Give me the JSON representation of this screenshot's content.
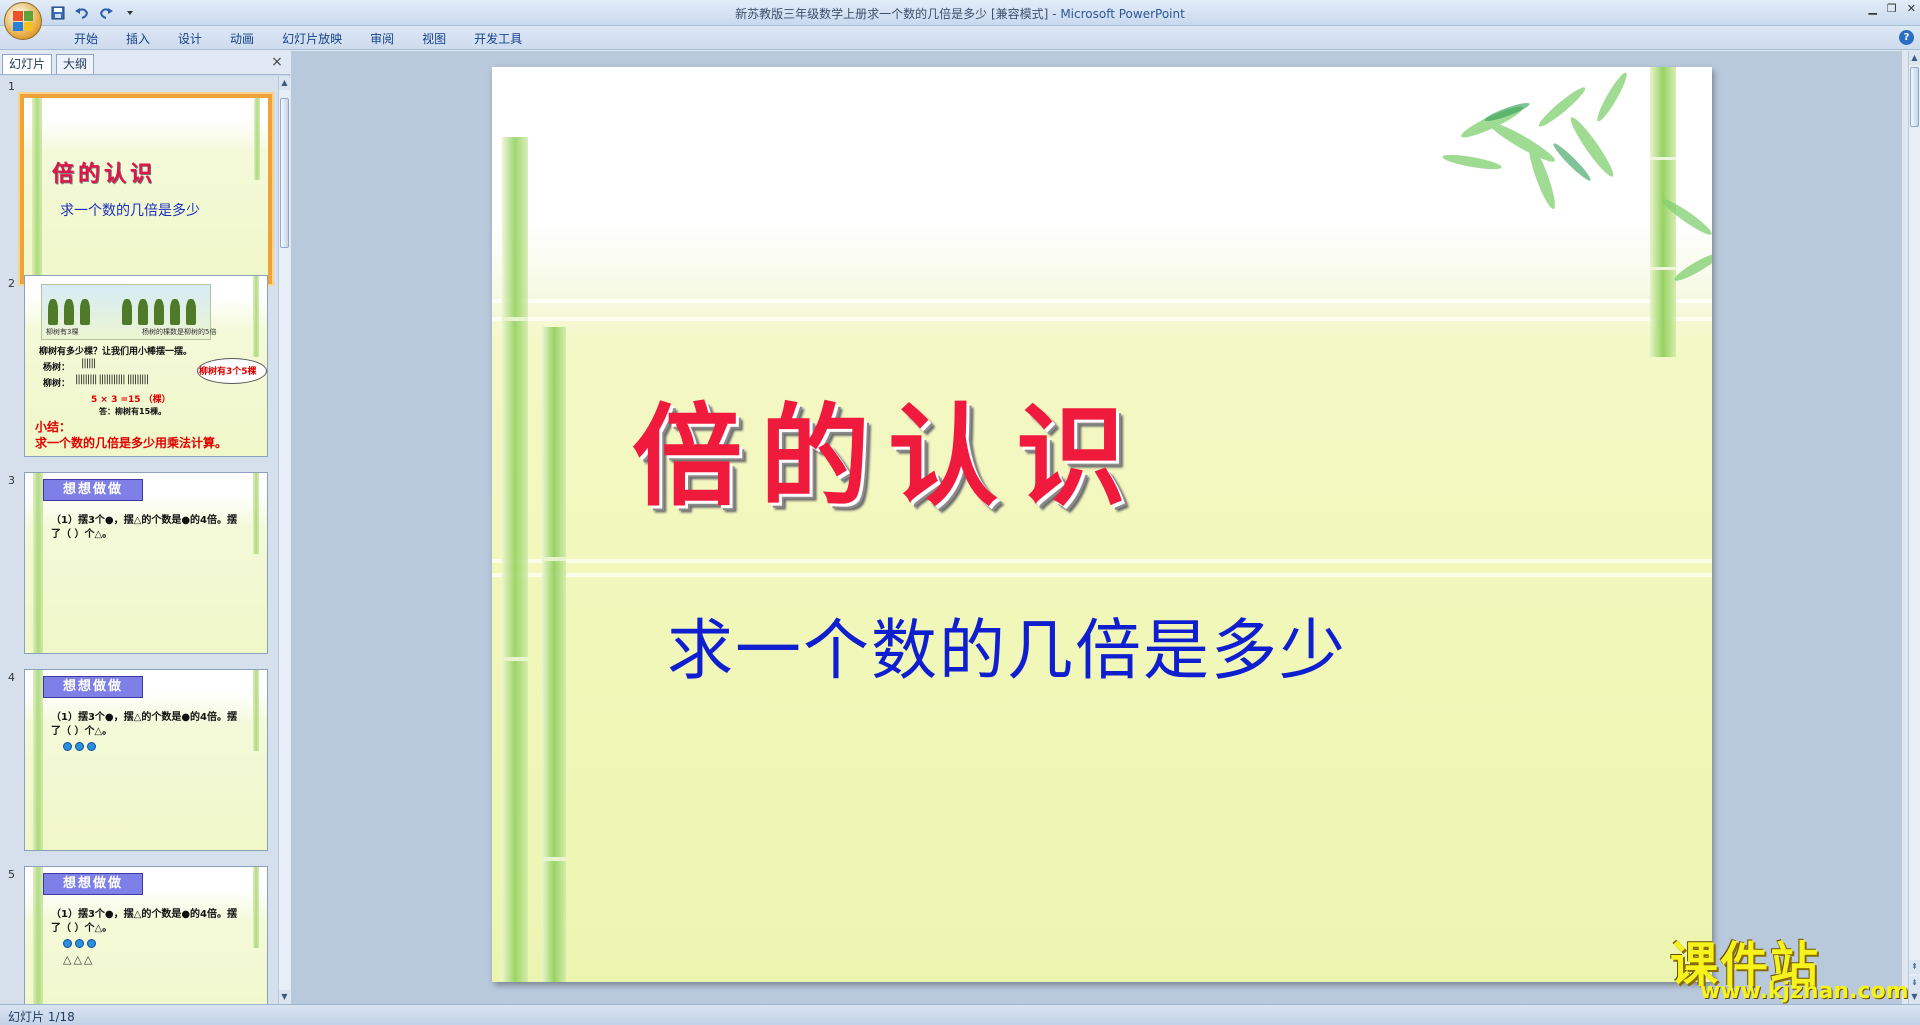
{
  "window": {
    "title": "新苏教版三年级数学上册求一个数的几倍是多少 [兼容模式]",
    "title_sep": " - ",
    "app_name": "Microsoft PowerPoint"
  },
  "ribbon": {
    "tabs": [
      "开始",
      "插入",
      "设计",
      "动画",
      "幻灯片放映",
      "审阅",
      "视图",
      "开发工具"
    ]
  },
  "left_pane": {
    "tabs": [
      "幻灯片",
      "大纲"
    ],
    "close_glyph": "×"
  },
  "thumbnails": [
    {
      "num": "1",
      "title": "倍的认识",
      "subtitle": "求一个数的几倍是多少"
    },
    {
      "num": "2",
      "pic_label_left": "柳树有3棵",
      "pic_label_right": "杨树的棵数是柳树的5倍",
      "line1": "柳树有多少棵？让我们用小棒摆一摆。",
      "line2": "杨树：",
      "line3": "柳树：",
      "eq": "5 × 3 =15 （棵）",
      "answer": "答：柳树有15棵。",
      "cloud": "柳树有3个5棵",
      "summary_label": "小结：",
      "summary": "求一个数的几倍是多少用乘法计算。"
    },
    {
      "num": "3",
      "banner": "想想做做",
      "line1": "（1）摆3个●，摆△的个数是●的4倍。摆",
      "line2": "了（  ）个△。"
    },
    {
      "num": "4",
      "banner": "想想做做",
      "line1": "（1）摆3个●，摆△的个数是●的4倍。摆",
      "line2": "了（  ）个△。"
    },
    {
      "num": "5",
      "banner": "想想做做",
      "line1": "（1）摆3个●，摆△的个数是●的4倍。摆",
      "line2": "了（  ）个△。",
      "tris": "△△△"
    }
  ],
  "slide": {
    "title": "倍的认识",
    "subtitle": "求一个数的几倍是多少"
  },
  "watermark": {
    "cn": "课件站",
    "url": "www.kjzhan.com"
  },
  "status": {
    "slide_counter": "幻灯片 1/18"
  },
  "colors": {
    "slide_title": "#f01a3c",
    "slide_subtitle": "#0f1fd0",
    "selection": "#f0a23a"
  }
}
